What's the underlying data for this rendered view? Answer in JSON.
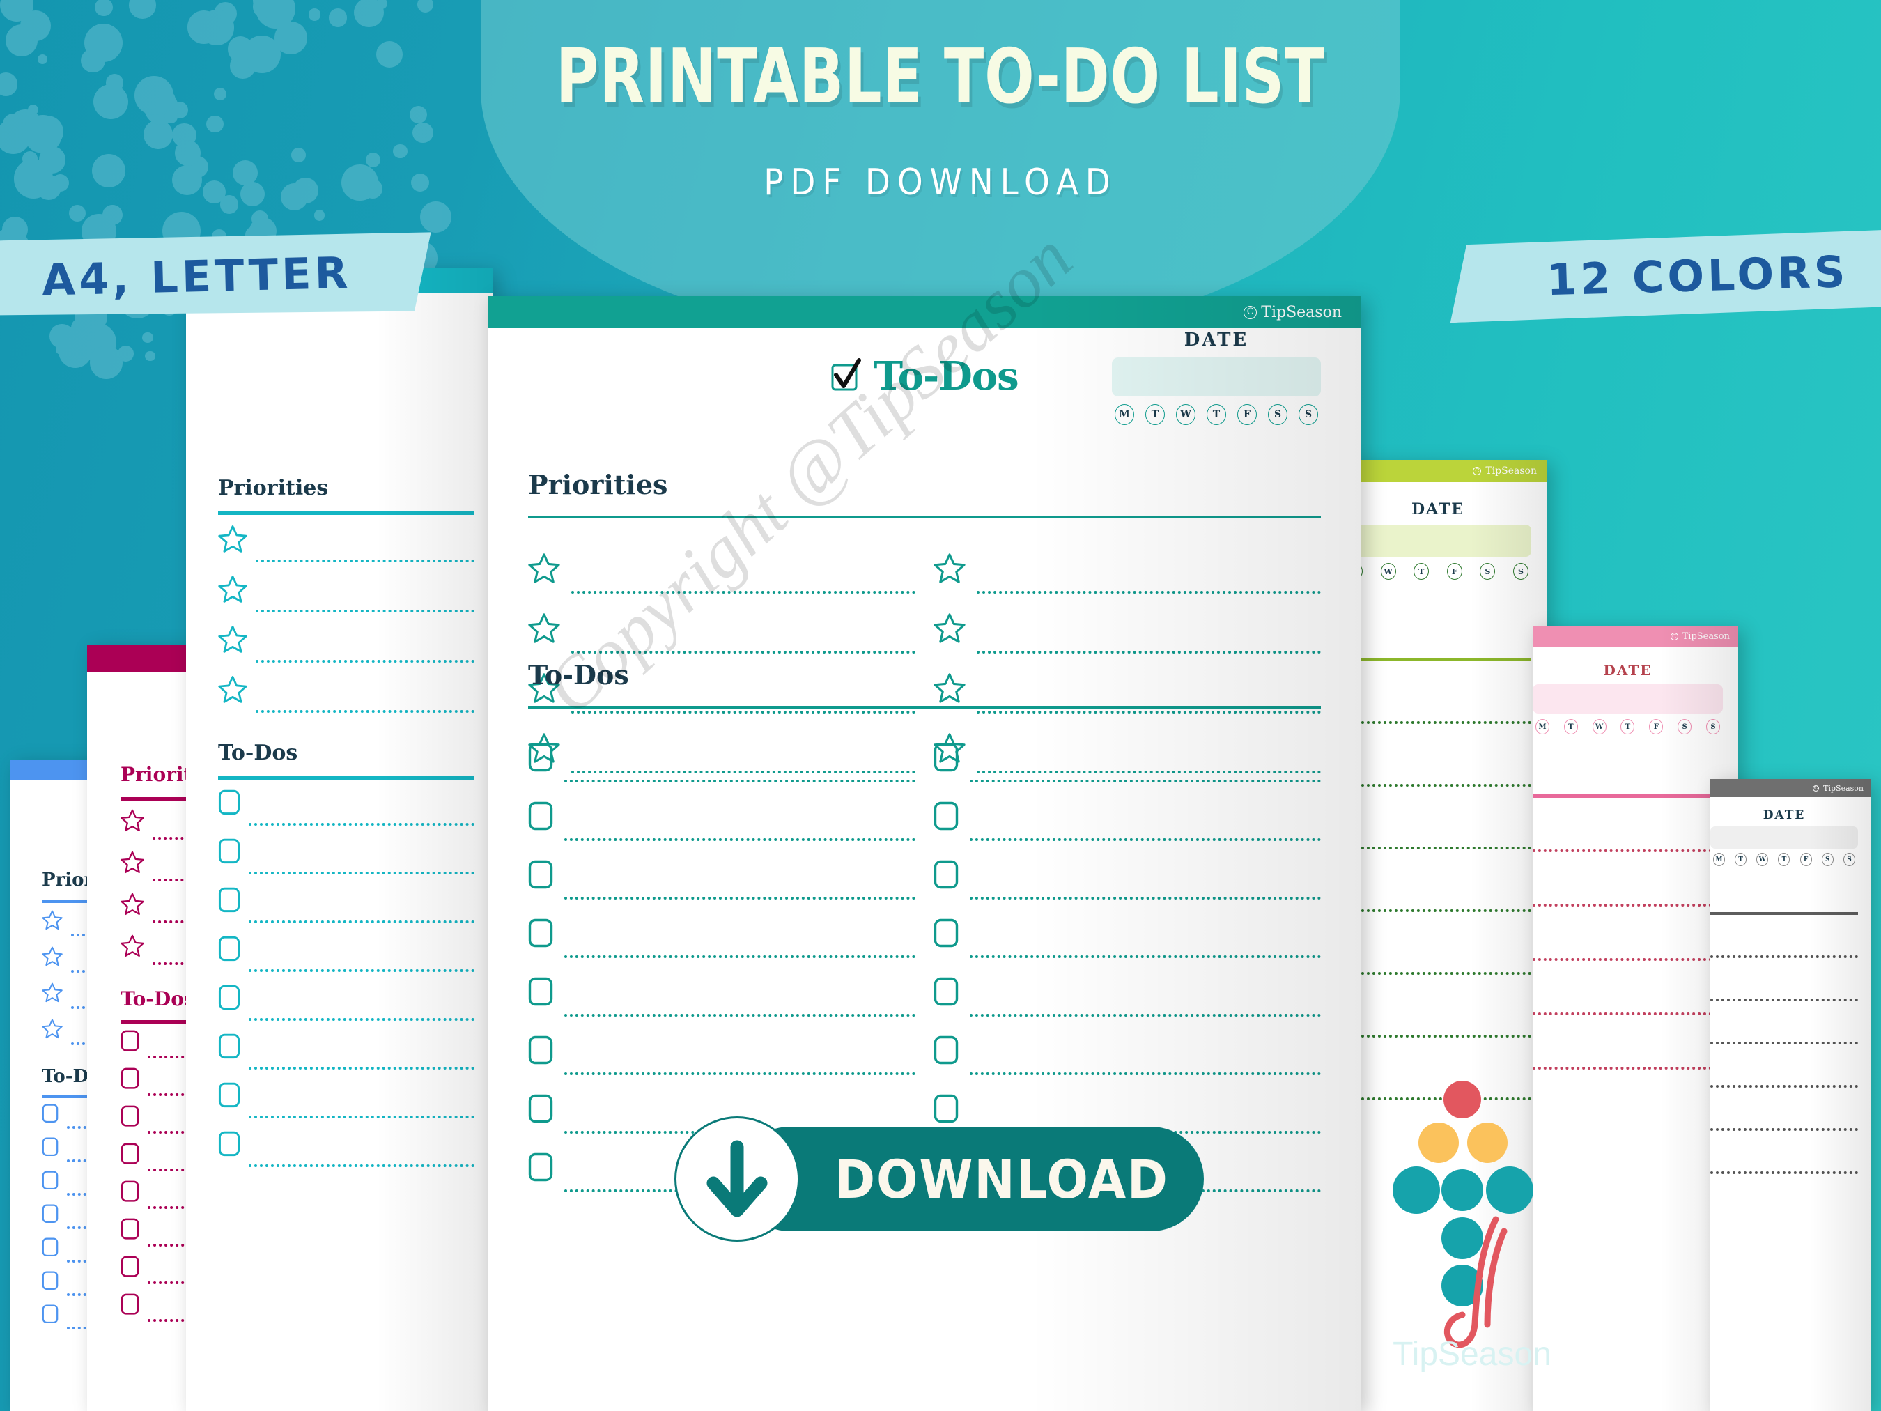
{
  "poster": {
    "title": "PRINTABLE TO-DO LIST",
    "subtitle": "PDF DOWNLOAD",
    "badge_left": "A4, LETTER",
    "badge_right": "12 COLORS",
    "watermark": "Copyright @TipSeason",
    "bg_color": "#189cb4",
    "accent_color": "#0f9a8d",
    "badge_text_color": "#1d5a9e",
    "badge_bg_color": "#b6e6ec"
  },
  "download": {
    "label": "DOWNLOAD",
    "icon": "download-arrow-icon",
    "bg_color": "#0a7a78"
  },
  "brand": {
    "name": "TipSeason",
    "copyright_symbol": "C",
    "logo_label": "TipSeason",
    "logo_dot_colors": [
      "#e2575f",
      "#fbc25c",
      "#fbc25c",
      "#16a3ab",
      "#16a3ab",
      "#16a3ab",
      "#16a3ab",
      "#16a3ab"
    ],
    "logo_swoosh_color": "#e2575f"
  },
  "main_sheet": {
    "header_color": "#11a192",
    "accent_color": "#0f9a8d",
    "title": "To-Dos",
    "title_icon": "checked-checkbox-icon",
    "date_label": "DATE",
    "days": [
      "M",
      "T",
      "W",
      "T",
      "F",
      "S",
      "S"
    ],
    "sections": [
      {
        "heading": "Priorities",
        "marker": "star-icon",
        "rows": 4,
        "columns": 2
      },
      {
        "heading": "To-Dos",
        "marker": "checkbox-icon",
        "rows": 8,
        "columns": 2
      }
    ]
  },
  "back_sheets": [
    {
      "id": "blue",
      "band_color": "#4d94f0",
      "accent_color": "#4d94f0",
      "text_color": "#1b3a4b",
      "headings": [
        "Priorities",
        "To-Dos"
      ]
    },
    {
      "id": "crimson",
      "band_color": "#ab0055",
      "accent_color": "#ab0055",
      "text_color": "#ab0055",
      "headings": [
        "Priorities",
        "To-Dos"
      ]
    },
    {
      "id": "cyan",
      "band_color": "#14b6c4",
      "accent_color": "#14b6c4",
      "text_color": "#1b3a4b",
      "headings": [
        "Priorities",
        "To-Dos"
      ]
    },
    {
      "id": "lime",
      "band_color": "#bbd43a",
      "accent_color": "#8cb72b",
      "text_color": "#1b3a4b",
      "date_label": "DATE",
      "days": [
        "T",
        "W",
        "T",
        "F",
        "S",
        "S"
      ]
    },
    {
      "id": "pink",
      "band_color": "#ef8fb2",
      "accent_color": "#e8699a",
      "text_color": "#b5424d",
      "date_label": "DATE",
      "days": [
        "M",
        "T",
        "W",
        "T",
        "F",
        "S",
        "S"
      ]
    },
    {
      "id": "gray",
      "band_color": "#6f6f6f",
      "accent_color": "#5d5d5d",
      "text_color": "#1b3a4b",
      "date_label": "DATE",
      "days": [
        "M",
        "T",
        "W",
        "T",
        "F",
        "S",
        "S"
      ]
    }
  ]
}
